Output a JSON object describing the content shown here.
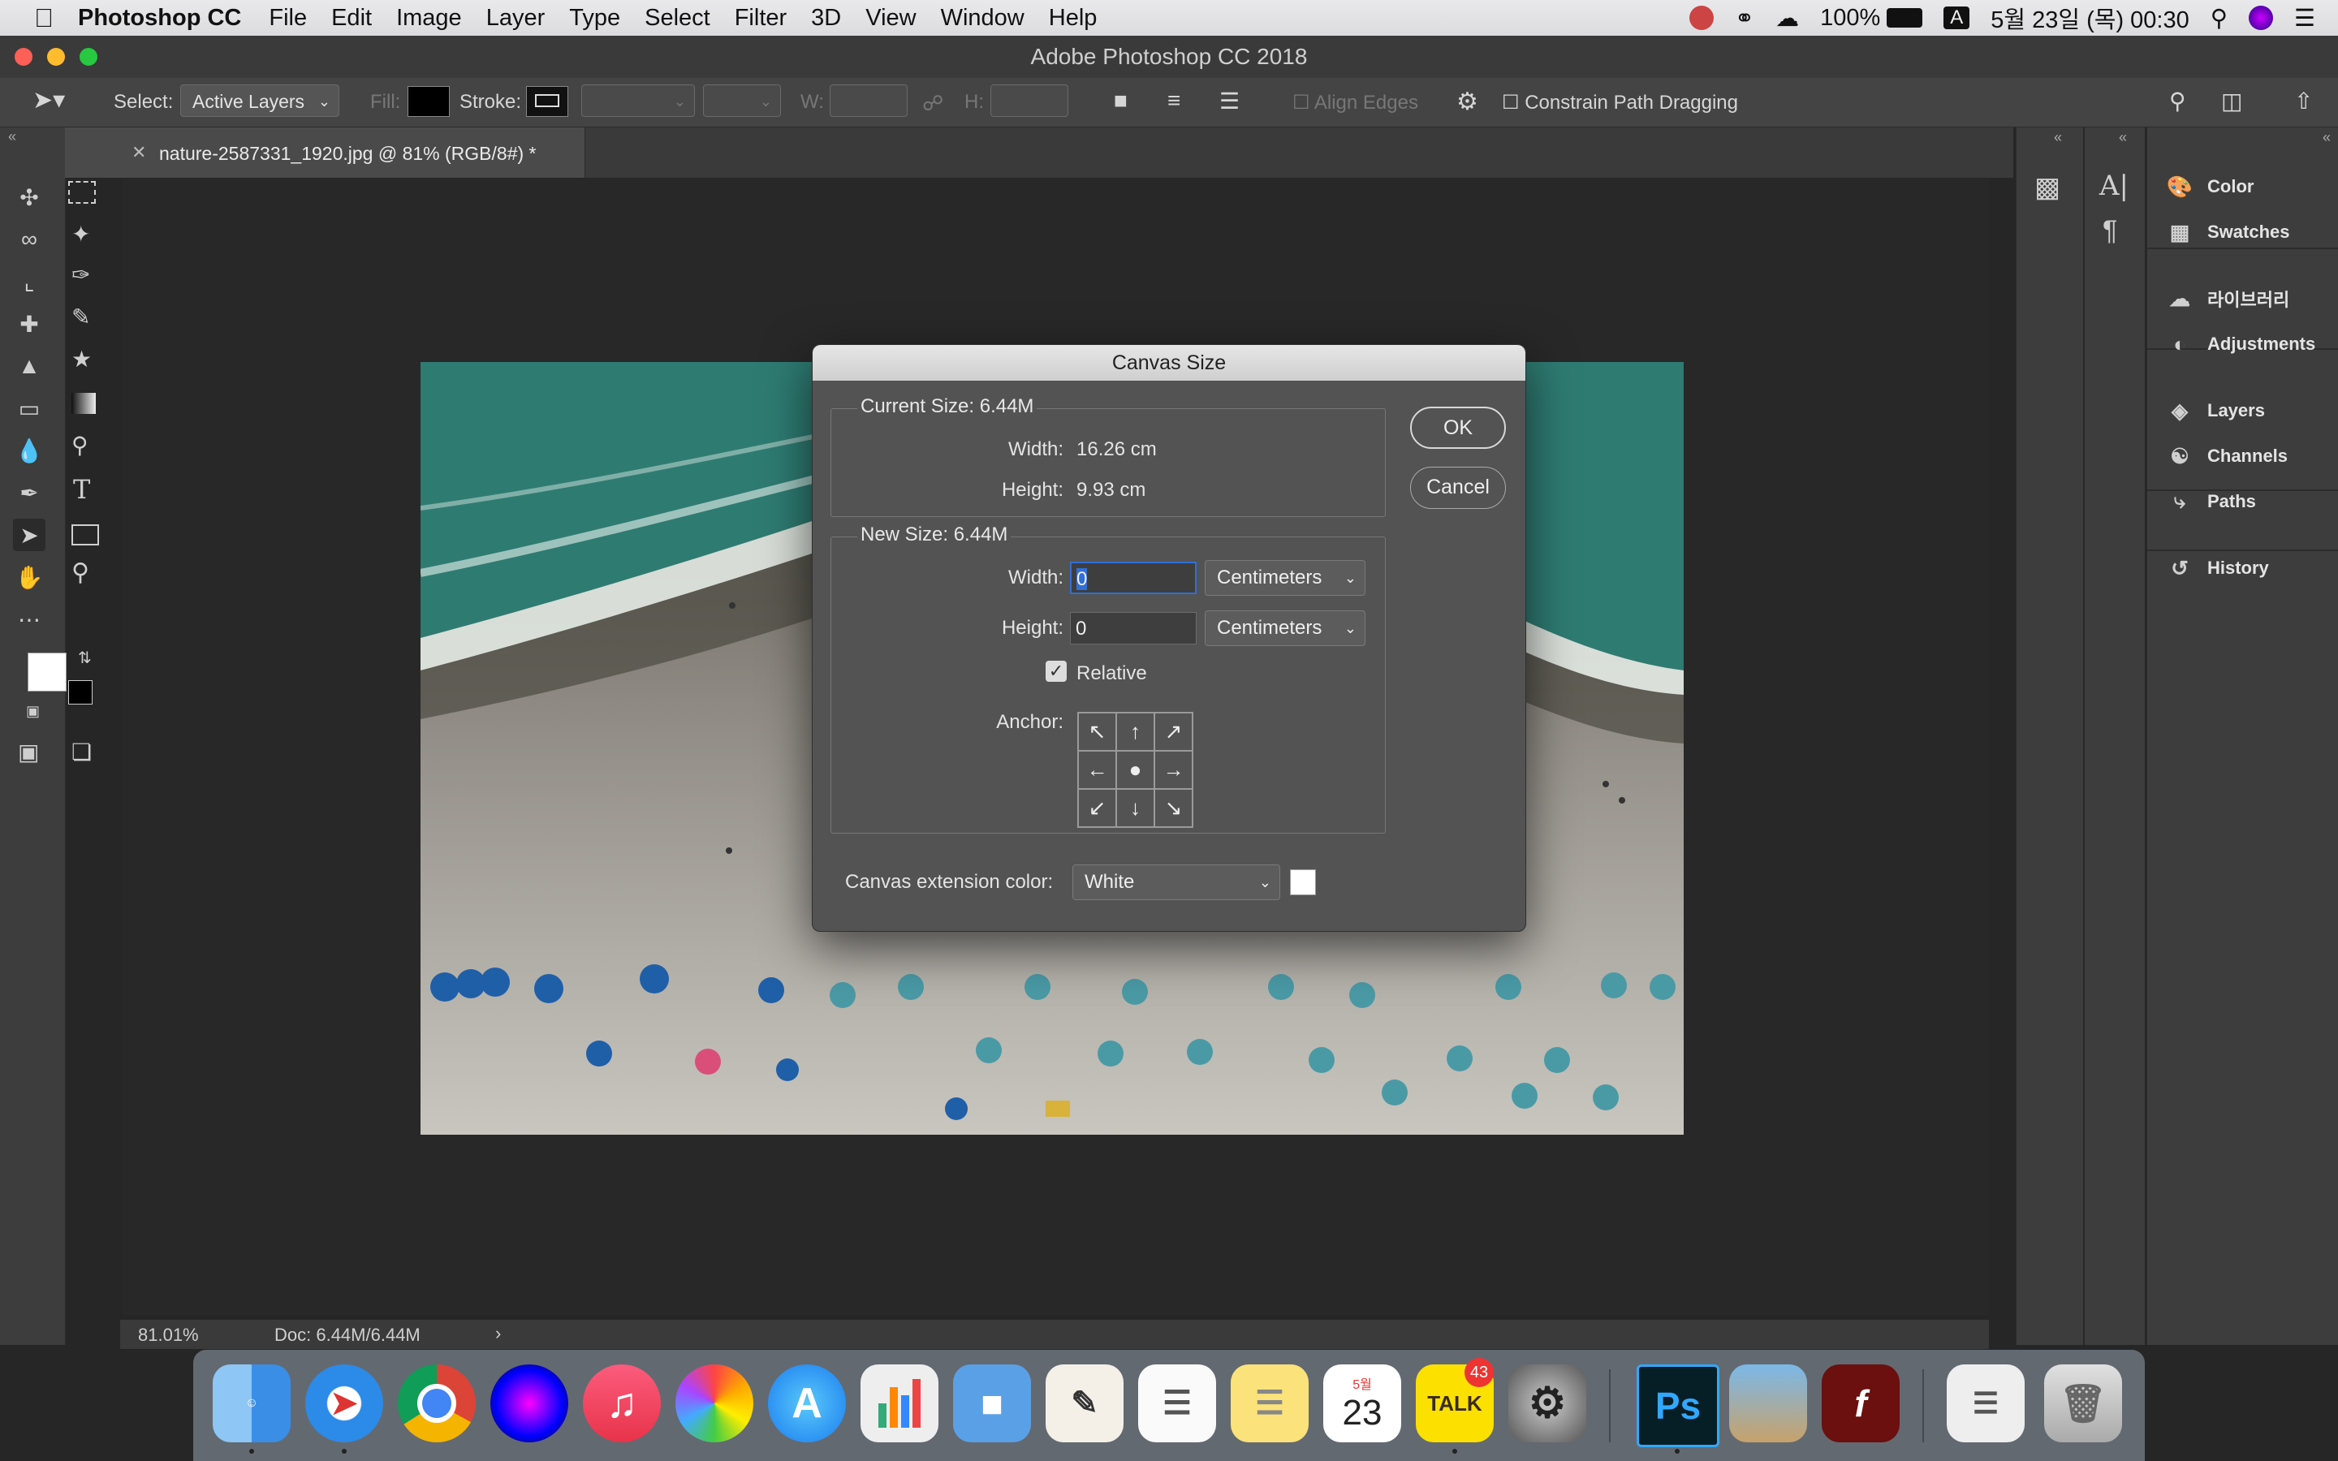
{
  "menubar": {
    "app_name": "Photoshop CC",
    "items": [
      "File",
      "Edit",
      "Image",
      "Layer",
      "Type",
      "Select",
      "Filter",
      "3D",
      "View",
      "Window",
      "Help"
    ],
    "battery": "100%",
    "input_source": "A",
    "datetime": "5월 23일 (목) 00:30"
  },
  "window": {
    "title": "Adobe Photoshop CC 2018"
  },
  "options_bar": {
    "select_label": "Select:",
    "select_value": "Active Layers",
    "fill_label": "Fill:",
    "stroke_label": "Stroke:",
    "w_label": "W:",
    "h_label": "H:",
    "align_edges": "Align Edges",
    "constrain": "Constrain Path Dragging"
  },
  "document": {
    "tab_label": "nature-2587331_1920.jpg @ 81% (RGB/8#) *",
    "zoom": "81.01%",
    "doc_info": "Doc: 6.44M/6.44M"
  },
  "panels": {
    "items": [
      {
        "label": "Color",
        "icon": "color-icon"
      },
      {
        "label": "Swatches",
        "icon": "swatches-icon"
      },
      {
        "label": "라이브러리",
        "icon": "libraries-icon"
      },
      {
        "label": "Adjustments",
        "icon": "adjustments-icon"
      },
      {
        "label": "Layers",
        "icon": "layers-icon"
      },
      {
        "label": "Channels",
        "icon": "channels-icon"
      },
      {
        "label": "Paths",
        "icon": "paths-icon"
      },
      {
        "label": "History",
        "icon": "history-icon"
      }
    ]
  },
  "dialog": {
    "title": "Canvas Size",
    "current_size_label": "Current Size: 6.44M",
    "width_label": "Width:",
    "height_label": "Height:",
    "current_width": "16.26 cm",
    "current_height": "9.93 cm",
    "new_size_label": "New Size: 6.44M",
    "new_width": "0",
    "new_height": "0",
    "unit": "Centimeters",
    "relative_label": "Relative",
    "relative_checked": true,
    "anchor_label": "Anchor:",
    "extension_label": "Canvas extension color:",
    "extension_value": "White",
    "ok": "OK",
    "cancel": "Cancel"
  },
  "dock": {
    "talk_badge": "43",
    "calendar_month": "5월",
    "calendar_day": "23"
  },
  "colors": {
    "accent_blue": "#2f6fd8",
    "ps_blue": "#31a8ff"
  }
}
